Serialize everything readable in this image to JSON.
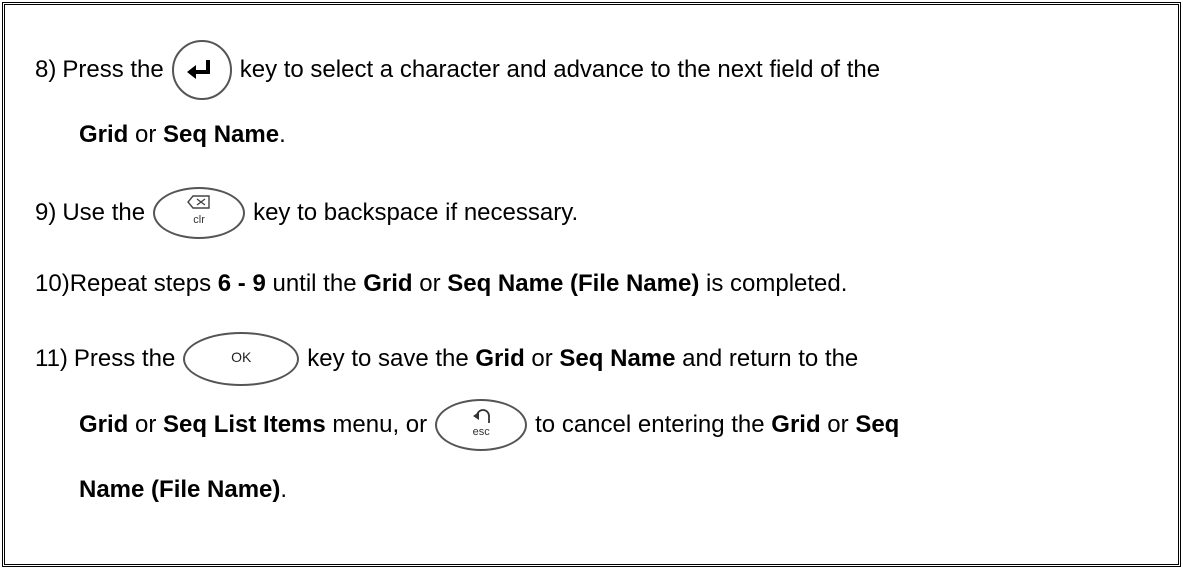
{
  "step8": {
    "num": "8)",
    "line1_pre": "Press the",
    "line1_post": "key to select a character and advance to the next field of the",
    "line2": [
      {
        "t": "Grid",
        "b": true
      },
      {
        "t": " or ",
        "b": false
      },
      {
        "t": "Seq Name",
        "b": true
      },
      {
        "t": ".",
        "b": false
      }
    ]
  },
  "step9": {
    "num": "9)",
    "pre": "Use the",
    "post": "key to backspace if necessary.",
    "key_label": "clr"
  },
  "step10": {
    "parts": [
      {
        "t": "10)Repeat steps ",
        "b": false
      },
      {
        "t": "6 - 9",
        "b": true
      },
      {
        "t": " until the ",
        "b": false
      },
      {
        "t": "Grid",
        "b": true
      },
      {
        "t": " or ",
        "b": false
      },
      {
        "t": "Seq Name (File Name)",
        "b": true
      },
      {
        "t": " is completed.",
        "b": false
      }
    ]
  },
  "step11": {
    "num": "11)",
    "line1_pre": "Press the",
    "ok_label": "OK",
    "line1_post": [
      {
        "t": "key to save the ",
        "b": false
      },
      {
        "t": "Grid",
        "b": true
      },
      {
        "t": " or ",
        "b": false
      },
      {
        "t": "Seq Name",
        "b": true
      },
      {
        "t": " and return to the",
        "b": false
      }
    ],
    "line2_pre": [
      {
        "t": "Grid",
        "b": true
      },
      {
        "t": " or ",
        "b": false
      },
      {
        "t": "Seq List Items",
        "b": true
      },
      {
        "t": " menu, or",
        "b": false
      }
    ],
    "esc_label": "esc",
    "line2_post": [
      {
        "t": "to cancel entering the ",
        "b": false
      },
      {
        "t": "Grid",
        "b": true
      },
      {
        "t": " or ",
        "b": false
      },
      {
        "t": "Seq",
        "b": true
      }
    ],
    "line3": [
      {
        "t": "Name (File Name)",
        "b": true
      },
      {
        "t": ".",
        "b": false
      }
    ]
  }
}
